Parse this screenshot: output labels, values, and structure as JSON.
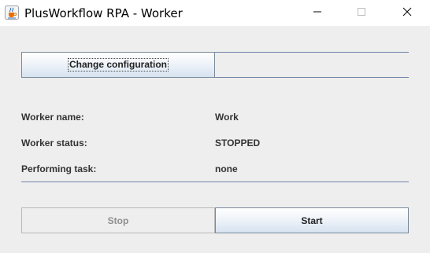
{
  "window": {
    "title": "PlusWorkflow RPA - Worker",
    "icon": "java-cup-icon"
  },
  "controls": {
    "minimize_icon": "minimize-icon",
    "maximize_icon": "maximize-icon",
    "close_icon": "close-icon"
  },
  "config": {
    "button_label": "Change configuration"
  },
  "info": {
    "worker_name_label": "Worker name:",
    "worker_name_value": "Work",
    "worker_status_label": "Worker status:",
    "worker_status_value": "STOPPED",
    "task_label": "Performing task:",
    "task_value": "none"
  },
  "actions": {
    "stop_label": "Stop",
    "stop_enabled": false,
    "start_label": "Start",
    "start_enabled": true
  },
  "colors": {
    "accent_line": "#6f82a8",
    "button_gradient_bottom": "#d6e3f0",
    "disabled_text": "#8e8e8e"
  }
}
